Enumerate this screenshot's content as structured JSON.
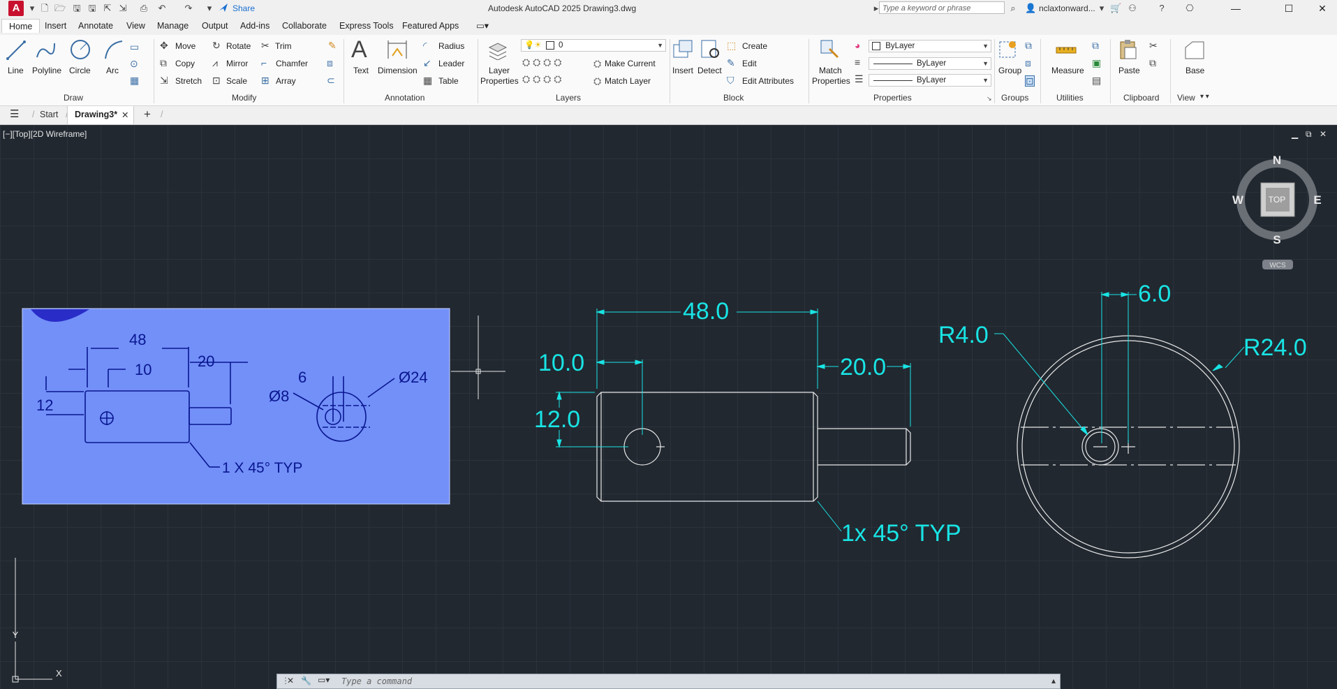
{
  "titlebar": {
    "app_logo": "A",
    "share_label": "Share",
    "title": "Autodesk AutoCAD 2025    Drawing3.dwg",
    "search_placeholder": "Type a keyword or phrase",
    "user": "nclaxtonward..."
  },
  "tabs": [
    "Home",
    "Insert",
    "Annotate",
    "View",
    "Manage",
    "Output",
    "Add-ins",
    "Collaborate",
    "Express Tools",
    "Featured Apps"
  ],
  "ribbon": {
    "draw": {
      "title": "Draw",
      "line": "Line",
      "polyline": "Polyline",
      "circle": "Circle",
      "arc": "Arc"
    },
    "modify": {
      "title": "Modify",
      "move": "Move",
      "rotate": "Rotate",
      "trim": "Trim",
      "copy": "Copy",
      "mirror": "Mirror",
      "chamfer": "Chamfer",
      "stretch": "Stretch",
      "scale": "Scale",
      "array": "Array"
    },
    "annotation": {
      "title": "Annotation",
      "text": "Text",
      "dimension": "Dimension",
      "radius": "Radius",
      "leader": "Leader",
      "table": "Table"
    },
    "layers": {
      "title": "Layers",
      "layer_properties_1": "Layer",
      "layer_properties_2": "Properties",
      "current_layer": "0",
      "make_current": "Make Current",
      "match_layer": "Match Layer"
    },
    "block": {
      "title": "Block",
      "insert": "Insert",
      "detect": "Detect",
      "create": "Create",
      "edit": "Edit",
      "edit_attributes": "Edit Attributes"
    },
    "properties": {
      "title": "Properties",
      "match_1": "Match",
      "match_2": "Properties",
      "color": "ByLayer",
      "linetype": "ByLayer",
      "lineweight": "ByLayer"
    },
    "groups": {
      "title": "Groups",
      "group": "Group"
    },
    "utilities": {
      "title": "Utilities",
      "measure": "Measure"
    },
    "clipboard": {
      "title": "Clipboard",
      "paste": "Paste"
    },
    "view": {
      "title": "View",
      "base": "Base"
    }
  },
  "filetabs": {
    "start": "Start",
    "drawing": "Drawing3*"
  },
  "viewport": {
    "label": "[−][Top][2D Wireframe]",
    "viewcube": {
      "n": "N",
      "s": "S",
      "e": "E",
      "w": "W",
      "top": "TOP",
      "wcs": "WCS"
    },
    "ucs": {
      "x": "X",
      "y": "Y"
    }
  },
  "reference_image": {
    "dim_48": "48",
    "dim_20": "20",
    "dim_10": "10",
    "dim_12": "12",
    "dim_6": "6",
    "dim_d8": "Ø8",
    "dim_d24": "Ø24",
    "note": "1 X 45° TYP"
  },
  "drawing": {
    "dim_48": "48.0",
    "dim_10": "10.0",
    "dim_20": "20.0",
    "dim_12": "12.0",
    "dim_6": "6.0",
    "dim_r4": "R4.0",
    "dim_r24": "R24.0",
    "note": "1x 45° TYP"
  },
  "command": {
    "placeholder": "Type a command"
  },
  "colors": {
    "dimension": "#19e4e4",
    "geometry": "#e8e8e8",
    "background": "#212830",
    "reference_tint": "#6f8ff8"
  }
}
